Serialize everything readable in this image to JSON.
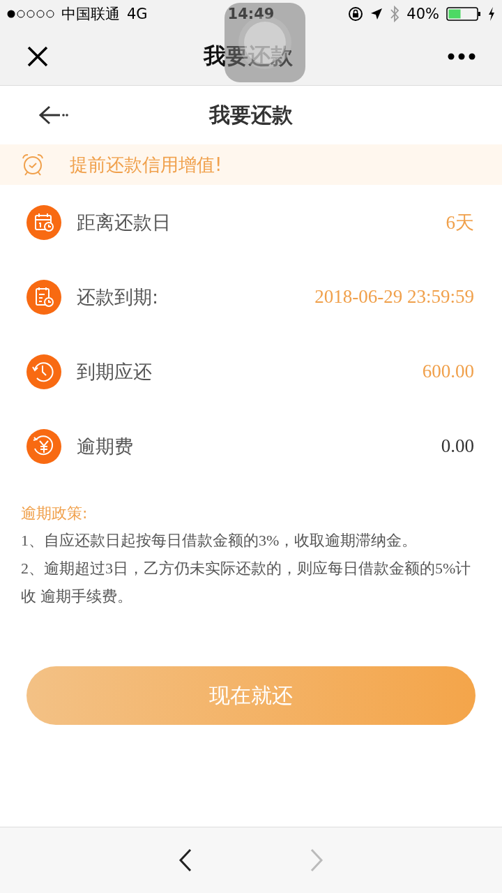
{
  "status_bar": {
    "carrier": "中国联通",
    "network": "4G",
    "time": "14:49",
    "battery": "40%"
  },
  "nav_bar": {
    "title": "我要还款"
  },
  "page_header": {
    "title": "我要还款"
  },
  "banner": {
    "text": "提前还款信用增值!"
  },
  "rows": [
    {
      "kind": "days",
      "label": "距离还款日",
      "value": "6天",
      "highlighted": true
    },
    {
      "kind": "due",
      "label": "还款到期:",
      "value": "2018-06-29 23:59:59",
      "highlighted": true
    },
    {
      "kind": "amount",
      "label": "到期应还",
      "value": "600.00",
      "highlighted": true
    },
    {
      "kind": "fee",
      "label": "逾期费",
      "value": "0.00",
      "highlighted": false
    }
  ],
  "policy": {
    "title": "逾期政策:",
    "lines": [
      "1、自应还款日起按每日借款金额的3%，收取逾期滞纳金。",
      "2、逾期超过3日，乙方仍未实际还款的，则应每日借款金额的5%计收 逾期手续费。"
    ]
  },
  "pay_button": {
    "label": "现在就还"
  },
  "toolbar": {
    "back_disabled": false,
    "forward_disabled": true
  }
}
